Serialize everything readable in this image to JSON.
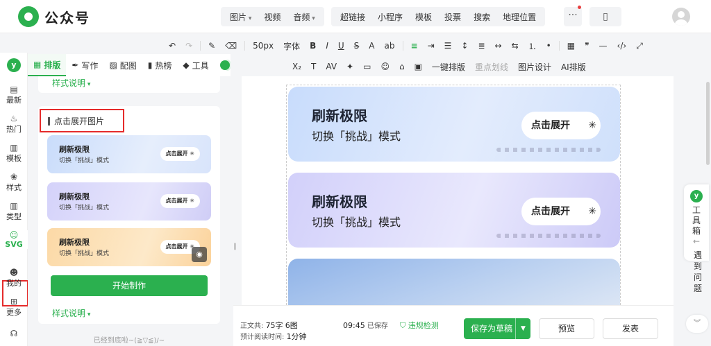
{
  "app": {
    "title": "公众号"
  },
  "insert_menu": {
    "group1": [
      "图片",
      "视频",
      "音频"
    ],
    "group2": [
      "超链接",
      "小程序",
      "模板",
      "投票",
      "搜索",
      "地理位置"
    ],
    "more": "···"
  },
  "format_toolbar": {
    "font_size": "50px",
    "font_family": "字体",
    "one_click_layout": "一键排版",
    "highlight": "重点划线",
    "image_design": "图片设计",
    "ai_layout": "AI排版"
  },
  "left_nav": {
    "items": [
      "最新",
      "热门",
      "模板",
      "样式",
      "类型",
      "SVG",
      "我的",
      "更多"
    ]
  },
  "panel_tabs": [
    "排版",
    "写作",
    "配图",
    "热榜",
    "工具"
  ],
  "panel": {
    "style_note": "样式说明",
    "card_title": "点击展开图片",
    "thumbs": [
      {
        "title": "刷新极限",
        "subtitle": "切换「挑战」模式",
        "button": "点击展开",
        "theme": "blue"
      },
      {
        "title": "刷新极限",
        "subtitle": "切换「挑战」模式",
        "button": "点击展开",
        "theme": "purple"
      },
      {
        "title": "刷新极限",
        "subtitle": "切换「挑战」模式",
        "button": "点击展开",
        "theme": "orange"
      }
    ],
    "start_button": "开始制作",
    "bottom_note": "已经到底啦~(≧▽≦)/~"
  },
  "editor": {
    "blocks": [
      {
        "title": "刷新极限",
        "subtitle": "切换「挑战」模式",
        "button": "点击展开"
      },
      {
        "title": "刷新极限",
        "subtitle": "切换「挑战」模式",
        "button": "点击展开"
      }
    ]
  },
  "status": {
    "body_label": "正文共:",
    "word_count": "75字",
    "image_count": "6图",
    "read_label": "预计阅读时间:",
    "read_time": "1分钟",
    "saved_time": "09:45",
    "saved_label": "已保存",
    "violation_check": "违规检测"
  },
  "actions": {
    "save_draft": "保存为草稿",
    "preview": "预览",
    "publish": "发表"
  },
  "right_tools": {
    "toolbox": "工具箱",
    "help": "遇到问题"
  },
  "colors": {
    "accent": "#2bb04f",
    "highlight_border": "#e52b2b"
  }
}
